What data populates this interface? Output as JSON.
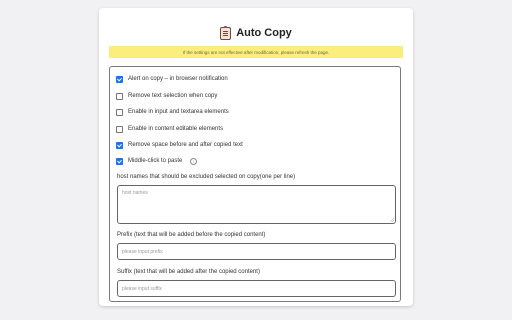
{
  "header": {
    "title": "Auto Copy",
    "icon": "clipboard-icon"
  },
  "notice": "If the settings are not effective after modification, please refresh the page.",
  "options": [
    {
      "label": "Alert on copy – in browser notification",
      "checked": true
    },
    {
      "label": "Remove text selection when copy",
      "checked": false
    },
    {
      "label": "Enable in input and textarea elements",
      "checked": false
    },
    {
      "label": "Enable in content editable elements",
      "checked": false
    },
    {
      "label": "Remove space before and after copied text",
      "checked": true
    },
    {
      "label": "Middle-click to paste",
      "checked": true,
      "info": "i"
    }
  ],
  "exclusion": {
    "label": "host names that should be excluded selected on copy(one per line)",
    "placeholder": "host names"
  },
  "prefix": {
    "label": "Prefix (text that will be added before the copied content)",
    "placeholder": "please input prefix"
  },
  "suffix": {
    "label": "Suffix (text that will be added after the copied content)",
    "placeholder": "please input suffix"
  },
  "colors": {
    "accent": "#1a73e8",
    "notice_bg": "#fbee7d",
    "page_bg": "#f1f1f3"
  }
}
